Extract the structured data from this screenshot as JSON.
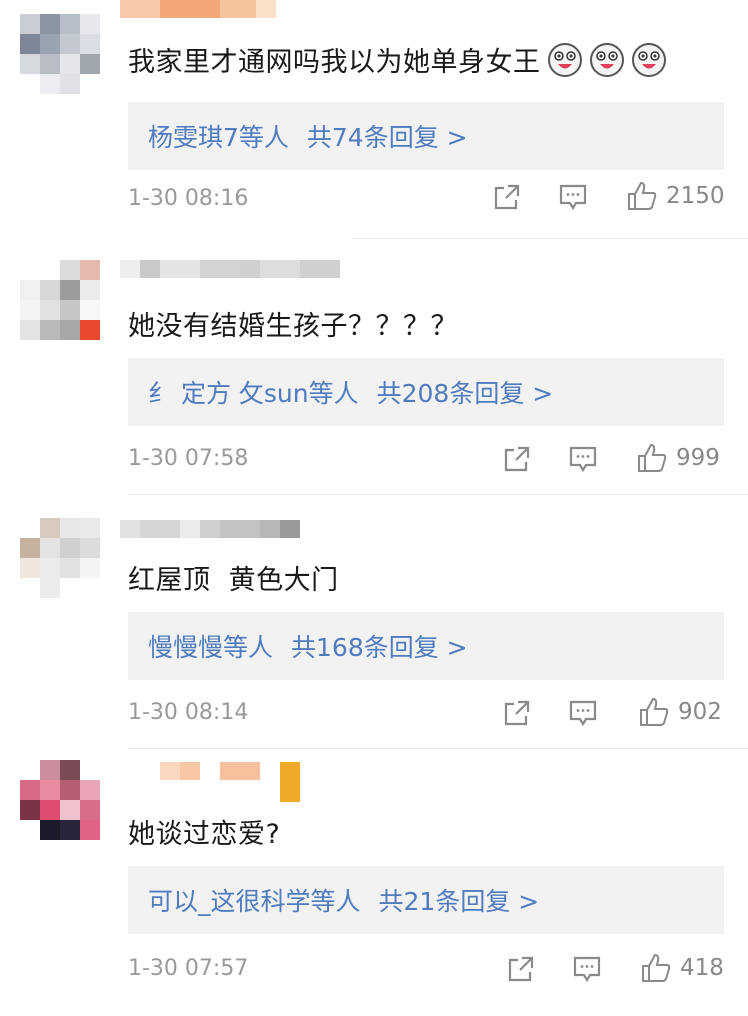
{
  "comments": [
    {
      "text": "我家里才通网吗我以为她单身女王",
      "emoji_icons": [
        "laugh-cry-emoji-icon",
        "laugh-cry-emoji-icon",
        "laugh-cry-emoji-icon"
      ],
      "reply_summary": "杨雯琪7等人",
      "reply_count": "共74条回复 >",
      "time": "1-30 08:16",
      "likes": "2150"
    },
    {
      "text": "她没有结婚生孩子？？？？",
      "emoji_icons": [],
      "reply_summary": "纟 定方 攵sun等人",
      "reply_count": "共208条回复 >",
      "time": "1-30 07:58",
      "likes": "999"
    },
    {
      "text": "红屋顶  黄色大门",
      "emoji_icons": [],
      "reply_summary": "慢慢慢等人",
      "reply_count": "共168条回复 >",
      "time": "1-30 08:14",
      "likes": "902"
    },
    {
      "text": "她谈过恋爱?",
      "emoji_icons": [],
      "reply_summary": "可以_这很科学等人",
      "reply_count": "共21条回复 >",
      "time": "1-30 07:57",
      "likes": "418"
    }
  ],
  "icons": {
    "share": "share-icon",
    "comment": "comment-icon",
    "like": "thumbs-up-icon"
  },
  "colors": {
    "link_blue": "#4f7bbf",
    "reply_bg": "#f2f2f2",
    "meta_gray": "#999999"
  }
}
